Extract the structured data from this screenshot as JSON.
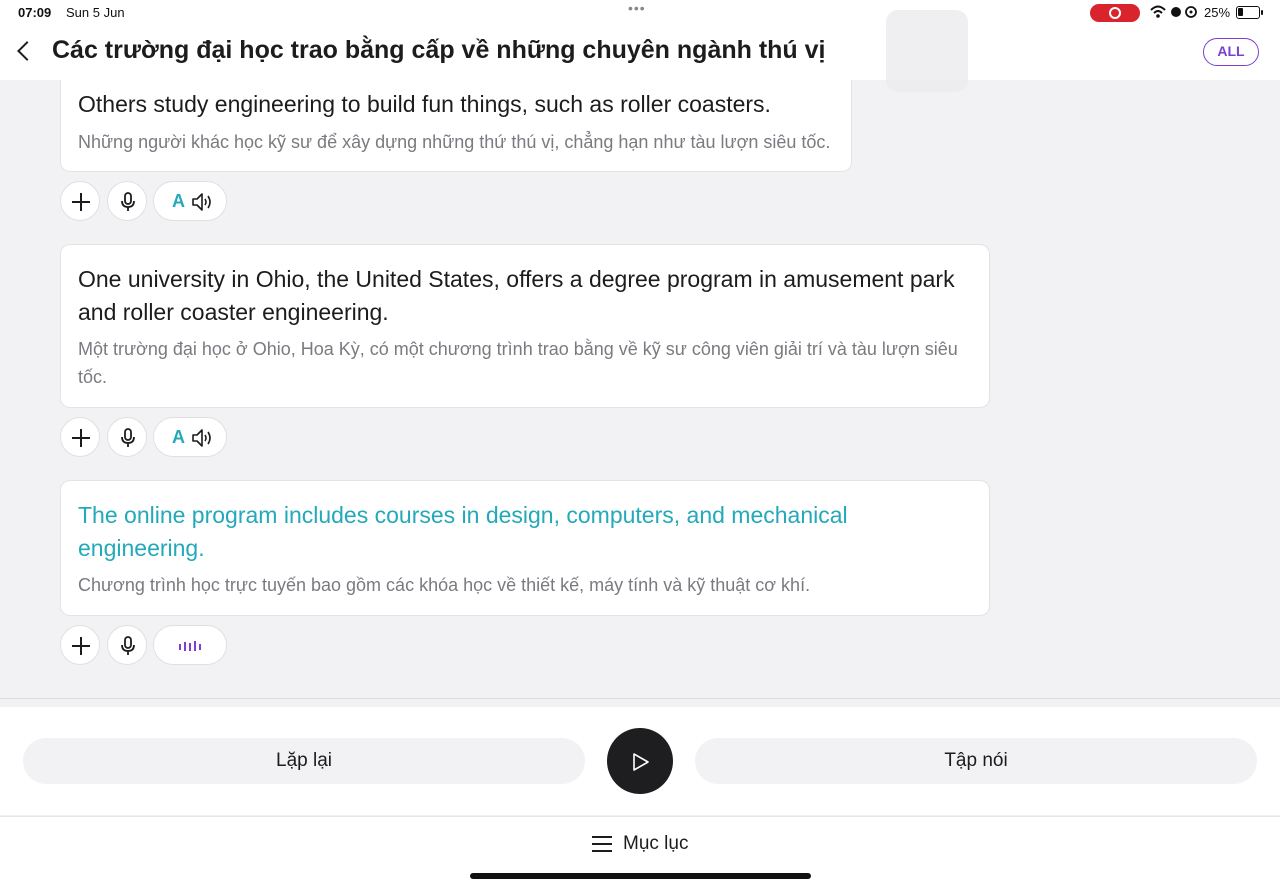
{
  "status_bar": {
    "time": "07:09",
    "date": "Sun 5 Jun",
    "battery": "25%"
  },
  "header": {
    "title": "Các trường đại học trao bằng cấp về những chuyên ngành thú vị",
    "all_label": "ALL"
  },
  "sentences": [
    {
      "en": "Others study engineering to build fun things, such as roller coasters.",
      "vi": "Những người khác học kỹ sư để xây dựng những thứ thú vị, chẳng hạn như tàu lượn siêu tốc.",
      "speaker_letter": "A",
      "playing": false
    },
    {
      "en": "One university in Ohio, the United States, offers a degree program in amusement park and roller coaster engineering.",
      "vi": "Một trường đại học ở Ohio, Hoa Kỳ, có một chương trình trao bằng về kỹ sư công viên giải trí và tàu lượn siêu tốc.",
      "speaker_letter": "A",
      "playing": false
    },
    {
      "en": "The online program includes courses in design, computers, and mechanical engineering.",
      "vi": "Chương trình học trực tuyến bao gồm các khóa học về thiết kế, máy tính và kỹ thuật cơ khí.",
      "playing": true
    }
  ],
  "controls": {
    "repeat_label": "Lặp lại",
    "speak_label": "Tập nói",
    "toc_label": "Mục lục"
  },
  "colors": {
    "accent_teal": "#23a9b9",
    "accent_purple": "#7b3fd1",
    "record_red": "#d9232d"
  }
}
